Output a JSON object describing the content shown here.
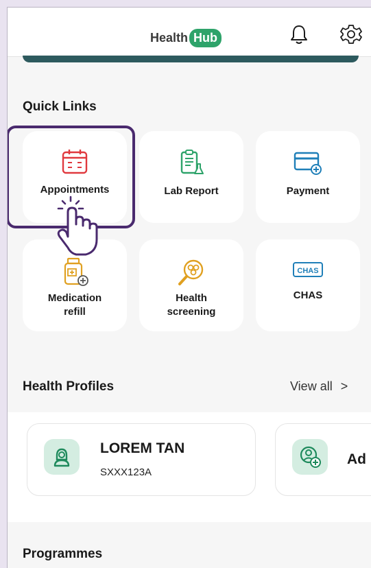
{
  "app": {
    "logo_left": "Health",
    "logo_right": "Hub"
  },
  "header": {
    "bell_icon": "bell-icon",
    "settings_icon": "gear-icon"
  },
  "quick_links": {
    "title": "Quick Links",
    "items": [
      {
        "label": "Appointments",
        "icon": "calendar-icon",
        "color": "#e0393e"
      },
      {
        "label": "Lab Report",
        "icon": "clipboard-flask-icon",
        "color": "#2ea36a"
      },
      {
        "label": "Payment",
        "icon": "card-plus-icon",
        "color": "#1f7fb8"
      },
      {
        "label": "Medication\nrefill",
        "icon": "pill-bottle-icon",
        "color": "#e0a020"
      },
      {
        "label": "Health\nscreening",
        "icon": "magnifier-cells-icon",
        "color": "#e0a020"
      },
      {
        "label": "CHAS",
        "icon": "chas-badge-icon",
        "color": "#1f7fb8",
        "badge_text": "CHAS"
      }
    ]
  },
  "health_profiles": {
    "title": "Health Profiles",
    "view_all": "View all",
    "chevron": ">",
    "profiles": [
      {
        "name": "LOREM TAN",
        "id": "SXXX123A"
      },
      {
        "name": "Ad"
      }
    ]
  },
  "programmes": {
    "title": "Programmes"
  },
  "colors": {
    "accent_dark": "#2d5a5e",
    "highlight": "#4a2a6e",
    "green": "#2ea36a"
  }
}
